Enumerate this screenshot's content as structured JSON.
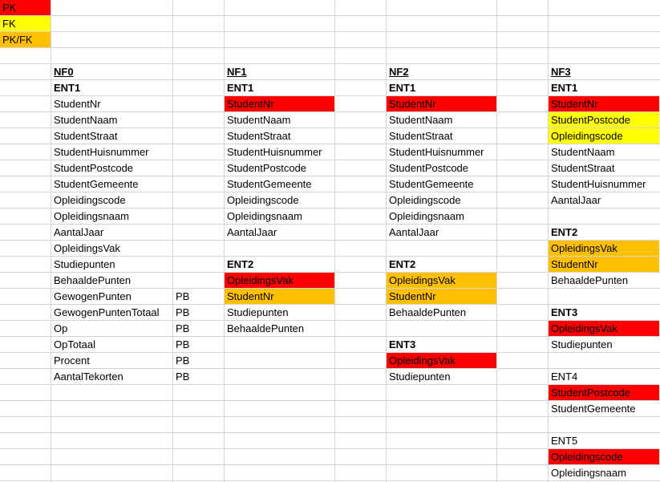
{
  "legend": [
    {
      "label": "PK",
      "color": "#ff0000"
    },
    {
      "label": "FK",
      "color": "#ffff00"
    },
    {
      "label": "PK/FK",
      "color": "#ffc000"
    }
  ],
  "colors": {
    "pk": "#ff0000",
    "fk": "#ffff00",
    "pkfk": "#ffc000",
    "grid": "#d4d4d4"
  },
  "columns": [
    {
      "header": "NF0",
      "rows": [
        {
          "text": "ENT1",
          "bold": true
        },
        {
          "text": "StudentNr"
        },
        {
          "text": "StudentNaam"
        },
        {
          "text": "StudentStraat"
        },
        {
          "text": "StudentHuisnummer"
        },
        {
          "text": "StudentPostcode"
        },
        {
          "text": "StudentGemeente"
        },
        {
          "text": "Opleidingscode"
        },
        {
          "text": "Opleidingsnaam"
        },
        {
          "text": "AantalJaar"
        },
        {
          "text": "OpleidingsVak"
        },
        {
          "text": "Studiepunten"
        },
        {
          "text": "BehaaldePunten"
        },
        {
          "text": "GewogenPunten",
          "note": "PB"
        },
        {
          "text": "GewogenPuntenTotaal",
          "note": "PB"
        },
        {
          "text": "Op",
          "note": "PB"
        },
        {
          "text": "OpTotaal",
          "note": "PB"
        },
        {
          "text": "Procent",
          "note": "PB"
        },
        {
          "text": "AantalTekorten",
          "note": "PB"
        }
      ]
    },
    {
      "header": "NF1",
      "rows": [
        {
          "text": "ENT1",
          "bold": true
        },
        {
          "text": "StudentNr",
          "key": "pk"
        },
        {
          "text": "StudentNaam"
        },
        {
          "text": "StudentStraat"
        },
        {
          "text": "StudentHuisnummer"
        },
        {
          "text": "StudentPostcode"
        },
        {
          "text": "StudentGemeente"
        },
        {
          "text": "Opleidingscode"
        },
        {
          "text": "Opleidingsnaam"
        },
        {
          "text": "AantalJaar"
        },
        {
          "text": ""
        },
        {
          "text": "ENT2",
          "bold": true
        },
        {
          "text": "OpleidingsVak",
          "key": "pk"
        },
        {
          "text": "StudentNr",
          "key": "pkfk"
        },
        {
          "text": "Studiepunten"
        },
        {
          "text": "BehaaldePunten"
        }
      ]
    },
    {
      "header": "NF2",
      "rows": [
        {
          "text": "ENT1",
          "bold": true
        },
        {
          "text": "StudentNr",
          "key": "pk"
        },
        {
          "text": "StudentNaam"
        },
        {
          "text": "StudentStraat"
        },
        {
          "text": "StudentHuisnummer"
        },
        {
          "text": "StudentPostcode"
        },
        {
          "text": "StudentGemeente"
        },
        {
          "text": "Opleidingscode"
        },
        {
          "text": "Opleidingsnaam"
        },
        {
          "text": "AantalJaar"
        },
        {
          "text": ""
        },
        {
          "text": "ENT2",
          "bold": true
        },
        {
          "text": "OpleidingsVak",
          "key": "pkfk"
        },
        {
          "text": "StudentNr",
          "key": "pkfk"
        },
        {
          "text": "BehaaldePunten"
        },
        {
          "text": ""
        },
        {
          "text": "ENT3",
          "bold": true
        },
        {
          "text": "OpleidingsVak",
          "key": "pk"
        },
        {
          "text": "Studiepunten"
        }
      ]
    },
    {
      "header": "NF3",
      "rows": [
        {
          "text": "ENT1",
          "bold": true
        },
        {
          "text": "StudentNr",
          "key": "pk"
        },
        {
          "text": "StudentPostcode",
          "key": "fk"
        },
        {
          "text": "Opleidingscode",
          "key": "fk"
        },
        {
          "text": "StudentNaam"
        },
        {
          "text": "StudentStraat"
        },
        {
          "text": "StudentHuisnummer"
        },
        {
          "text": "AantalJaar"
        },
        {
          "text": ""
        },
        {
          "text": "ENT2",
          "bold": true
        },
        {
          "text": "OpleidingsVak",
          "key": "pkfk"
        },
        {
          "text": "StudentNr",
          "key": "pkfk"
        },
        {
          "text": "BehaaldePunten"
        },
        {
          "text": ""
        },
        {
          "text": "ENT3",
          "bold": true
        },
        {
          "text": "OpleidingsVak",
          "key": "pk"
        },
        {
          "text": "Studiepunten"
        },
        {
          "text": ""
        },
        {
          "text": "ENT4"
        },
        {
          "text": "StudentPostcode",
          "key": "pk"
        },
        {
          "text": "StudentGemeente"
        },
        {
          "text": ""
        },
        {
          "text": "ENT5"
        },
        {
          "text": "Opleidingscode",
          "key": "pk"
        },
        {
          "text": "Opleidingsnaam"
        }
      ]
    }
  ]
}
